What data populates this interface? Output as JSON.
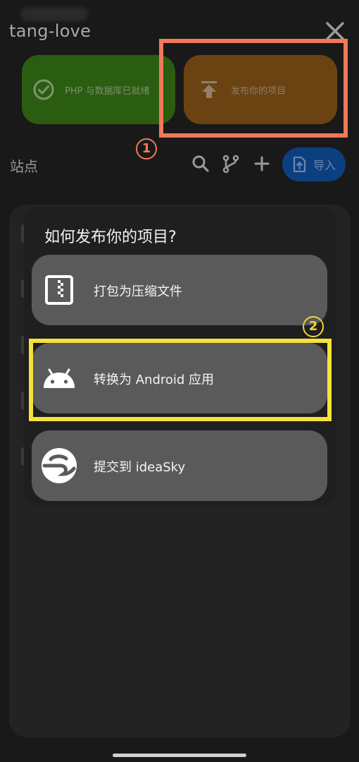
{
  "app": {
    "title": "tang-love"
  },
  "cards": {
    "php_status": "PHP 与数据库已就绪",
    "publish": "发布你的项目"
  },
  "annotations": {
    "step1": "1",
    "step2": "2",
    "box1_color": "#f0795a",
    "box2_color": "#f5e23a"
  },
  "sites": {
    "label": "站点",
    "import_label": "导入",
    "icons": [
      "search-icon",
      "branch-icon",
      "plus-icon",
      "import-icon"
    ]
  },
  "dialog": {
    "title": "如何发布你的项目?",
    "options": [
      {
        "label": "打包为压缩文件",
        "icon": "zip-file-icon"
      },
      {
        "label": "转换为 Android 应用",
        "icon": "android-icon"
      },
      {
        "label": "提交到 ideaSky",
        "icon": "ideasky-logo-icon"
      }
    ]
  },
  "colors": {
    "background": "#191919",
    "php_card": "#2b5d10",
    "publish_card": "#6b4313",
    "import_button": "#0c3f80",
    "option_background": "#5a5a5a"
  }
}
